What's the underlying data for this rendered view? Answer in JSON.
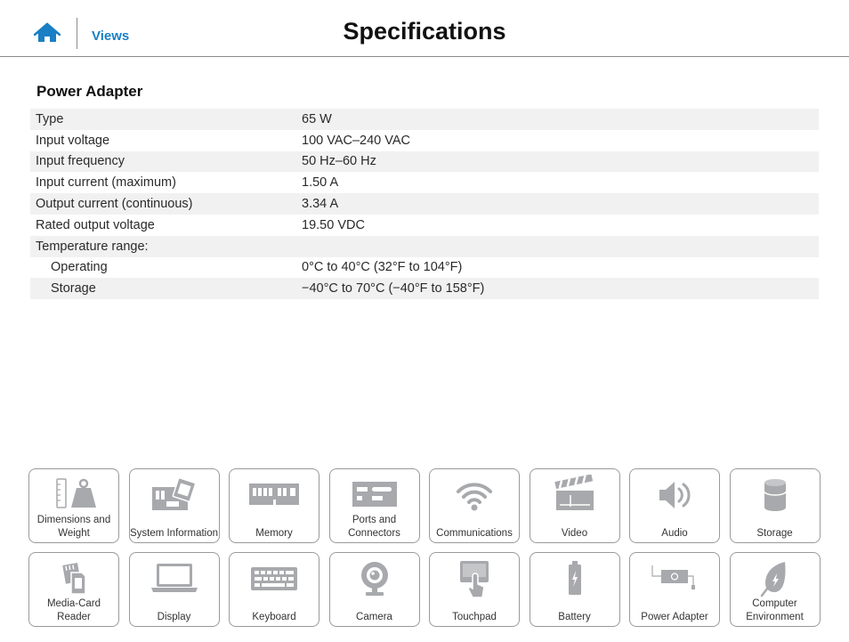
{
  "header": {
    "home_icon": "home-icon",
    "views_link": "Views",
    "title": "Specifications"
  },
  "colors": {
    "accent": "#1a7fc4",
    "icon_gray": "#a7a9ac",
    "row_shade": "#f1f1f1"
  },
  "section": {
    "title": "Power Adapter",
    "rows": [
      {
        "label": "Type",
        "value": "65 W"
      },
      {
        "label": "Input voltage",
        "value": "100 VAC–240 VAC"
      },
      {
        "label": "Input frequency",
        "value": "50 Hz–60 Hz"
      },
      {
        "label": "Input current (maximum)",
        "value": "1.50 A"
      },
      {
        "label": "Output current (continuous)",
        "value": "3.34 A"
      },
      {
        "label": "Rated output voltage",
        "value": "19.50 VDC"
      },
      {
        "label": "Temperature range:",
        "value": ""
      },
      {
        "label": "Operating",
        "value": "0°C to 40°C (32°F to 104°F)"
      },
      {
        "label": "Storage",
        "value": "−40°C to 70°C (−40°F to 158°F)"
      }
    ]
  },
  "tiles": [
    {
      "label": "Dimensions and Weight",
      "icon": "weight-icon"
    },
    {
      "label": "System Information",
      "icon": "motherboard-icon"
    },
    {
      "label": "Memory",
      "icon": "memory-icon"
    },
    {
      "label": "Ports and Connectors",
      "icon": "ports-icon"
    },
    {
      "label": "Communications",
      "icon": "wifi-icon"
    },
    {
      "label": "Video",
      "icon": "clapperboard-icon"
    },
    {
      "label": "Audio",
      "icon": "speaker-icon"
    },
    {
      "label": "Storage",
      "icon": "storage-icon"
    },
    {
      "label": "Media-Card Reader",
      "icon": "media-card-icon"
    },
    {
      "label": "Display",
      "icon": "laptop-icon"
    },
    {
      "label": "Keyboard",
      "icon": "keyboard-icon"
    },
    {
      "label": "Camera",
      "icon": "webcam-icon"
    },
    {
      "label": "Touchpad",
      "icon": "touchpad-icon"
    },
    {
      "label": "Battery",
      "icon": "battery-icon"
    },
    {
      "label": "Power Adapter",
      "icon": "power-adapter-icon"
    },
    {
      "label": "Computer Environment",
      "icon": "leaf-icon"
    }
  ]
}
